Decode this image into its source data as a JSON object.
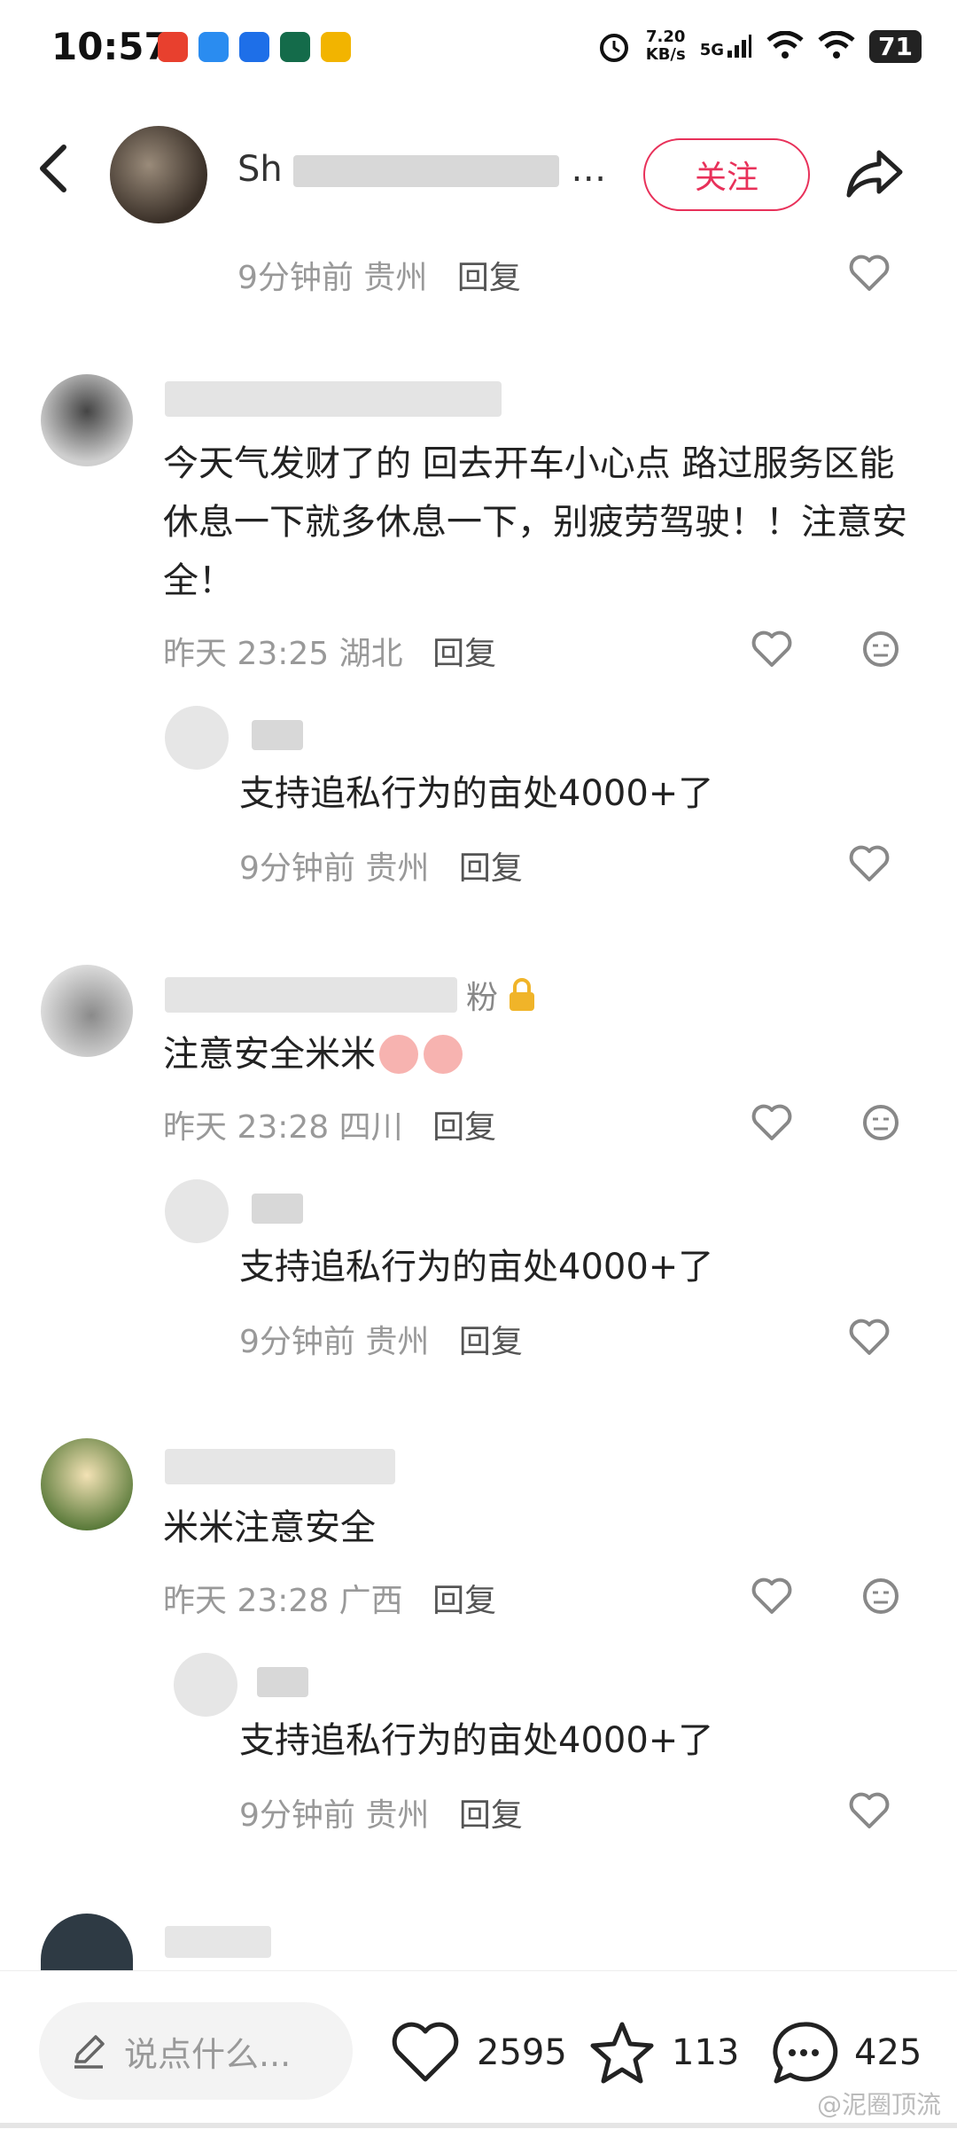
{
  "status_bar": {
    "time": "10:57",
    "network_speed": "7.20",
    "network_unit": "KB/s",
    "signal_label": "5G",
    "battery": "71"
  },
  "header": {
    "name_visible": "Sh",
    "name_suffix": "…",
    "follow_label": "关注"
  },
  "top_meta": {
    "time": "9分钟前",
    "location": "贵州",
    "reply": "回复"
  },
  "comments": [
    {
      "text": "今天气发财了的 回去开车小心点 路过服务区能休息一下就多休息一下，别疲劳驾驶！！注意安全！",
      "time": "昨天 23:25",
      "location": "湖北",
      "reply": "回复",
      "sub": {
        "text": "支持追私行为的亩处4000+了",
        "time": "9分钟前",
        "location": "贵州",
        "reply": "回复"
      }
    },
    {
      "text": "注意安全米米",
      "username_fragment": "粉",
      "time": "昨天 23:28",
      "location": "四川",
      "reply": "回复",
      "sub": {
        "text": "支持追私行为的亩处4000+了",
        "time": "9分钟前",
        "location": "贵州",
        "reply": "回复"
      }
    },
    {
      "text": "米米注意安全",
      "time": "昨天 23:28",
      "location": "广西",
      "reply": "回复",
      "sub": {
        "text": "支持追私行为的亩处4000+了",
        "time": "9分钟前",
        "location": "贵州",
        "reply": "回复"
      }
    }
  ],
  "bottom_bar": {
    "input_placeholder": "说点什么...",
    "likes": "2595",
    "favorites": "113",
    "comments": "425"
  },
  "watermark": "@泥圈顶流",
  "colors": {
    "accent": "#e8315a",
    "meta": "#999999"
  }
}
